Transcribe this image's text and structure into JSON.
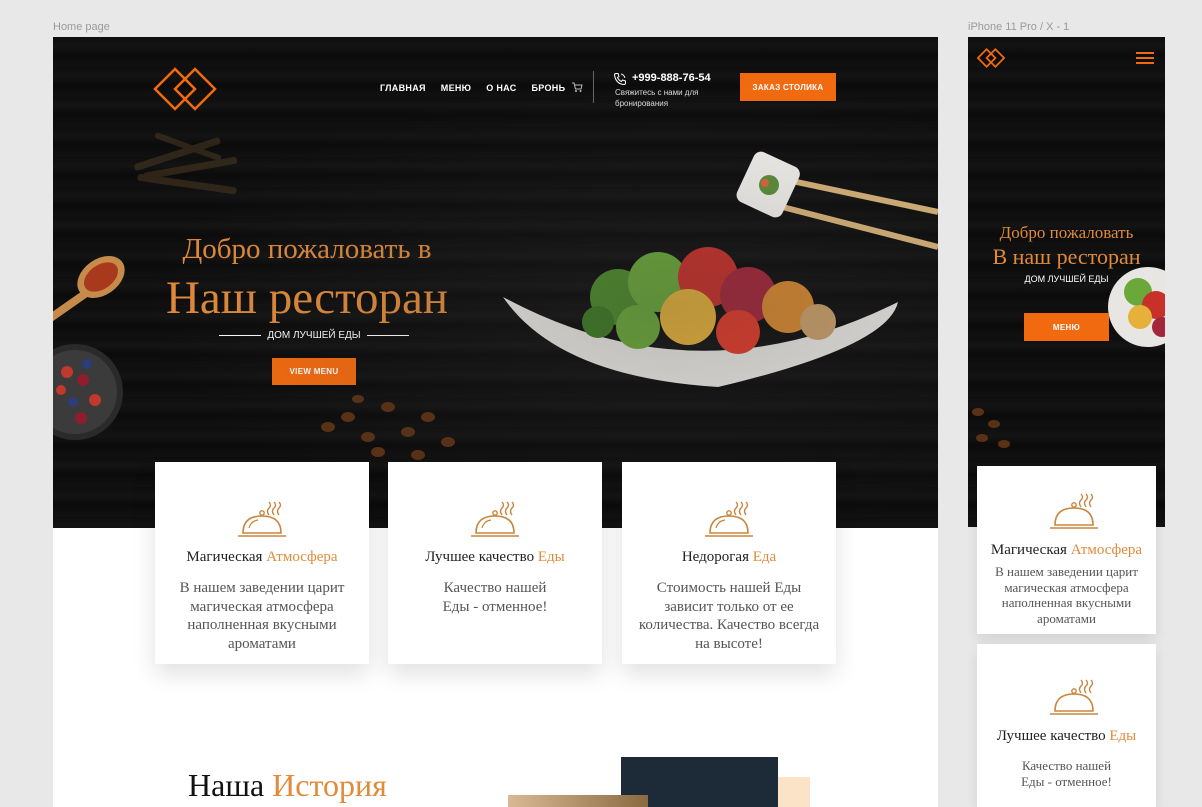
{
  "frames": {
    "desktop_label": "Home page",
    "mobile_label": "iPhone 11 Pro / X - 1"
  },
  "colors": {
    "accent": "#f26a10",
    "gold_text": "#e08a3a",
    "hero_bg": "#0e0e0e"
  },
  "header": {
    "logo_icon": "diamond-logo-icon",
    "nav": [
      "ГЛАВНАЯ",
      "МЕНЮ",
      "О НАС",
      "БРОНЬ"
    ],
    "cart_icon": "cart-icon",
    "phone_icon": "phone-icon",
    "phone": "+999-888-76-54",
    "phone_sub": "Свяжитесь с нами для бронирования",
    "book_button": "ЗАКАЗ СТОЛИКА"
  },
  "hero": {
    "welcome": "Добро пожаловать в",
    "title": "Наш ресторан",
    "tagline": "ДОМ ЛУЧШЕЙ ЕДЫ",
    "button": "VIEW MENU"
  },
  "features": [
    {
      "title": "Магическая",
      "title_accent": "Атмосфера",
      "text": "В нашем заведении царит магическая атмосфера наполненная вкусными ароматами",
      "icon": "cloche-icon"
    },
    {
      "title": "Лучшее качество",
      "title_accent": "Еды",
      "text": "Качество нашей Еды - отменное!",
      "icon": "cloche-icon"
    },
    {
      "title": "Недорогая",
      "title_accent": "Еда",
      "text": "Стоимость нашей Еды зависит только от ее количества. Качество всегда на высоте!",
      "icon": "cloche-icon"
    }
  ],
  "story": {
    "title": "Наша",
    "title_accent": "История"
  },
  "mobile": {
    "menu_icon": "hamburger-menu-icon",
    "welcome": "Добро пожаловать",
    "title": "В наш ресторан",
    "tagline": "ДОМ ЛУЧШЕЙ ЕДЫ",
    "button": "МЕНЮ",
    "cards": [
      {
        "title": "Магическая",
        "title_accent": "Атмосфера",
        "text": "В нашем заведении царит магическая атмосфера наполненная вкусными ароматами"
      },
      {
        "title": "Лучшее качество",
        "title_accent": "Еды",
        "text": "Качество нашей Еды - отменное!"
      }
    ]
  }
}
